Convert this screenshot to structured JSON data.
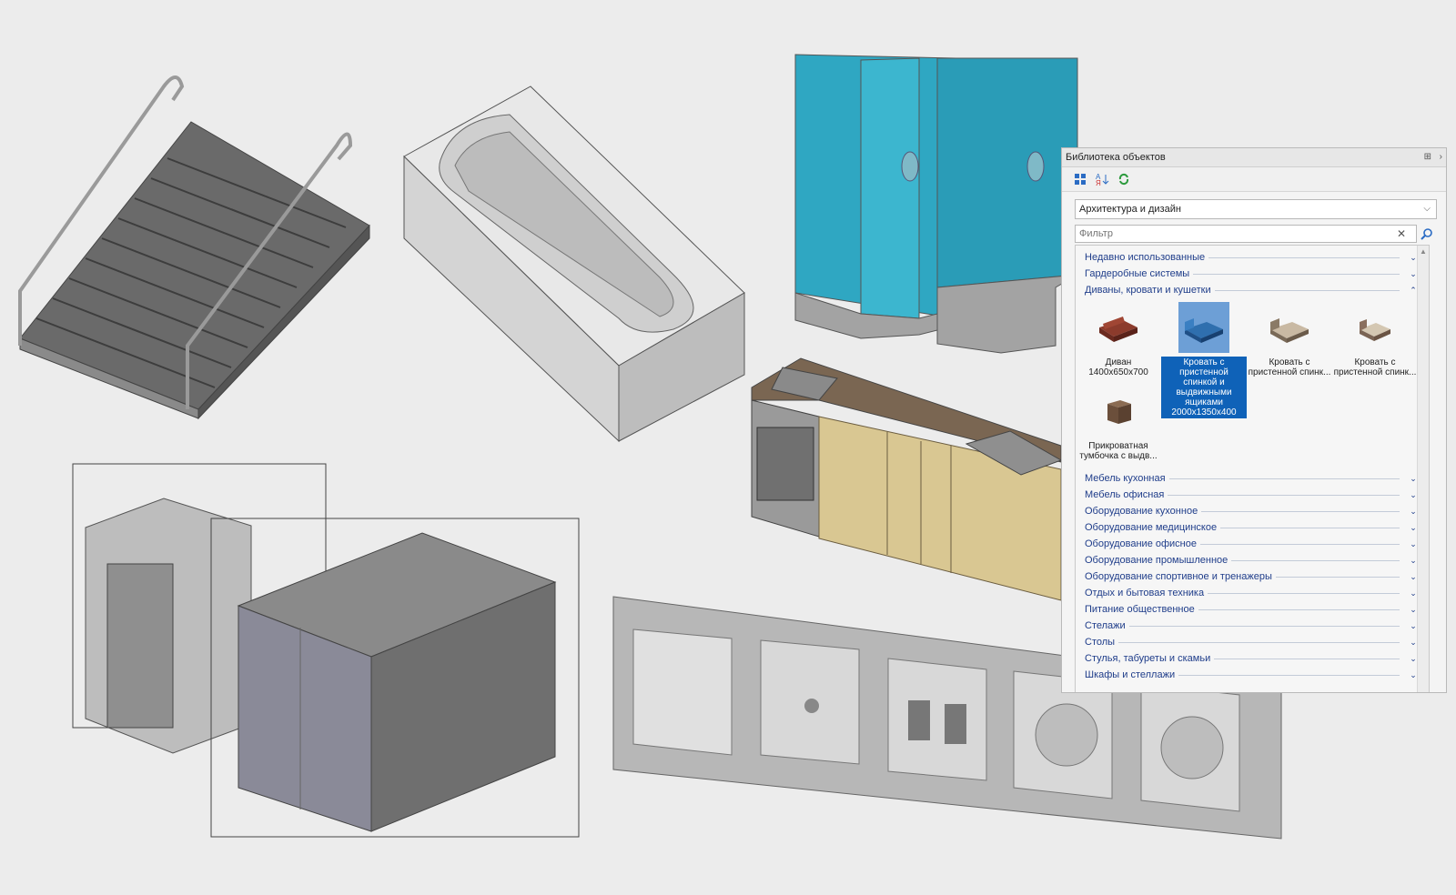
{
  "library": {
    "title": "Библиотека объектов",
    "title_buttons": [
      "pin-icon",
      "close-icon"
    ],
    "toolbar": [
      "grid-view-icon",
      "sort-alpha-icon",
      "refresh-icon"
    ],
    "category_select": "Архитектура и дизайн",
    "filter_placeholder": "Фильтр",
    "tree": {
      "top_categories": [
        {
          "label": "Недавно использованные",
          "expanded": false
        },
        {
          "label": "Гардеробные системы",
          "expanded": false
        },
        {
          "label": "Диваны, кровати и кушетки",
          "expanded": true
        }
      ],
      "items": [
        {
          "label": "Диван 1400x650x700",
          "selected": false,
          "icon": "sofa-icon"
        },
        {
          "label": "Кровать с пристенной спинкой и выдвижными ящиками 2000x1350x400",
          "selected": true,
          "icon": "bed-blue-icon"
        },
        {
          "label": "Кровать с пристенной спинк...",
          "selected": false,
          "icon": "bed-beige-icon"
        },
        {
          "label": "Кровать с пристенной спинк...",
          "selected": false,
          "icon": "bed-small-icon"
        },
        {
          "label": "Прикроватная тумбочка с выдв...",
          "selected": false,
          "icon": "nightstand-icon"
        }
      ],
      "bottom_categories": [
        {
          "label": "Мебель кухонная"
        },
        {
          "label": "Мебель офисная"
        },
        {
          "label": "Оборудование кухонное"
        },
        {
          "label": "Оборудование медицинское"
        },
        {
          "label": "Оборудование офисное"
        },
        {
          "label": "Оборудование промышленное"
        },
        {
          "label": "Оборудование спортивное и тренажеры"
        },
        {
          "label": "Отдых и бытовая техника"
        },
        {
          "label": "Питание общественное"
        },
        {
          "label": "Стелажи"
        },
        {
          "label": "Столы"
        },
        {
          "label": "Стулья, табуреты и скамьи"
        },
        {
          "label": "Шкафы и стеллажи"
        }
      ]
    }
  },
  "colors": {
    "link": "#1f3d8a",
    "selection": "#0f62b8",
    "glass": "#2fa7c2",
    "concrete": "#c9c9c9",
    "wood": "#d9c792"
  }
}
